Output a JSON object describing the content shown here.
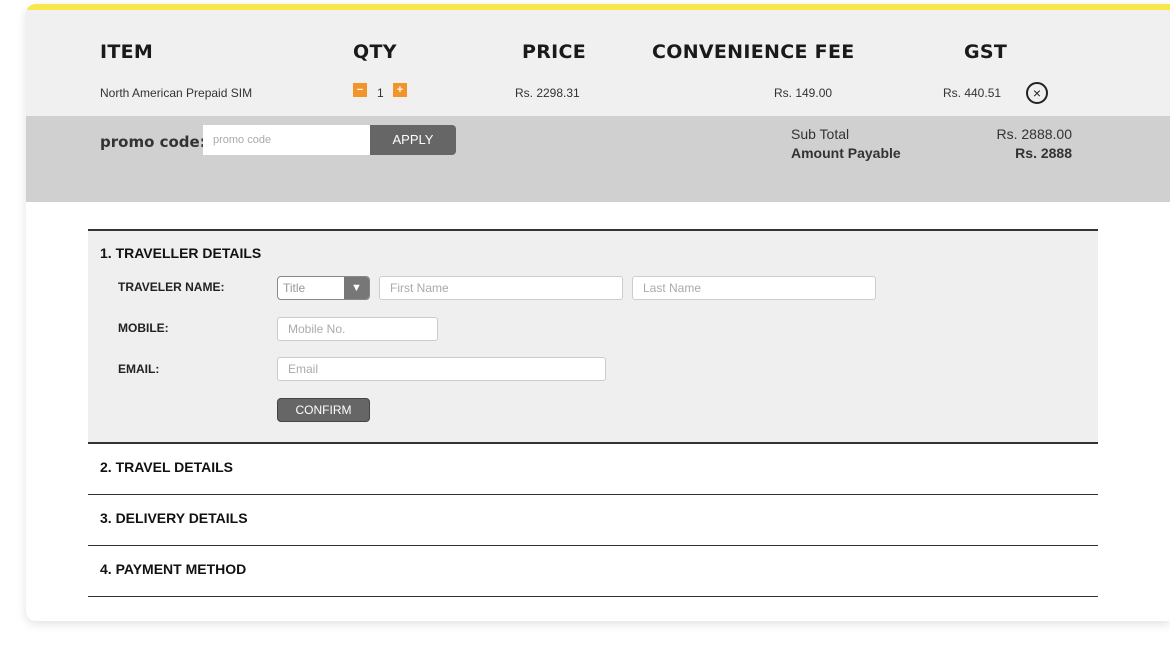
{
  "cart": {
    "headers": {
      "item": "ITEM",
      "qty": "QTY",
      "price": "PRICE",
      "fee": "CONVENIENCE FEE",
      "gst": "GST"
    },
    "row": {
      "item": "North American Prepaid SIM",
      "qty": "1",
      "minus": "−",
      "plus": "+",
      "price": "Rs. 2298.31",
      "fee": "Rs. 149.00",
      "gst": "Rs. 440.51",
      "remove_glyph": "×"
    }
  },
  "promo": {
    "label": "promo code:",
    "placeholder": "promo code",
    "apply": "APPLY"
  },
  "summary": {
    "subtotal_label": "Sub Total",
    "subtotal_value": "Rs. 2888.00",
    "payable_label": "Amount Payable",
    "payable_value": "Rs. 2888"
  },
  "sections": {
    "traveller": {
      "title": "1. TRAVELLER DETAILS",
      "name_label": "TRAVELER NAME:",
      "title_select": "Title",
      "first_name_placeholder": "First Name",
      "last_name_placeholder": "Last Name",
      "mobile_label": "MOBILE:",
      "mobile_placeholder": "Mobile No.",
      "email_label": "EMAIL:",
      "email_placeholder": "Email",
      "confirm": "CONFIRM"
    },
    "travel": {
      "title": "2. TRAVEL DETAILS"
    },
    "delivery": {
      "title": "3. DELIVERY DETAILS"
    },
    "payment": {
      "title": "4. PAYMENT METHOD"
    }
  },
  "colors": {
    "accent": "#f7e74a",
    "qty_button": "#f2942a",
    "button": "#666666"
  }
}
